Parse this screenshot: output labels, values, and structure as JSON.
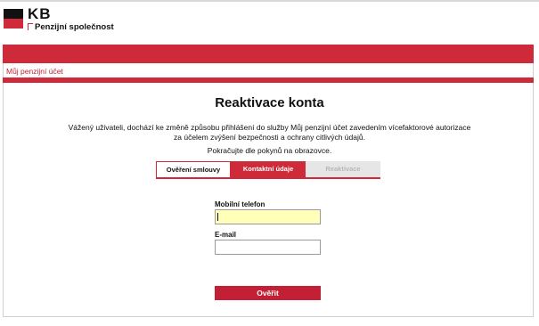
{
  "brand": {
    "logo_text": "KB",
    "subtitle": "Penzijní společnost",
    "colors": {
      "accent": "#cf2a3a",
      "dark": "#111111"
    }
  },
  "header": {
    "section_title": "Můj penzijní účet"
  },
  "main": {
    "title": "Reaktivace konta",
    "intro_line1": "Vážený uživateli, dochází ke změně způsobu přihlášení do služby Můj penzijní účet zavedením vícefaktorové autorizace",
    "intro_line2": "za účelem zvýšení bezpečnosti a ochrany citlivých údajů.",
    "continue_text": "Pokračujte dle pokynů na obrazovce."
  },
  "steps": [
    {
      "label": "Ověření smlouvy",
      "state": "done"
    },
    {
      "label": "Kontaktní údaje",
      "state": "active"
    },
    {
      "label": "Reaktivace",
      "state": "disabled"
    }
  ],
  "form": {
    "phone_label": "Mobilní telefon",
    "phone_value": "",
    "email_label": "E-mail",
    "email_value": "",
    "submit_label": "Ověřit"
  }
}
